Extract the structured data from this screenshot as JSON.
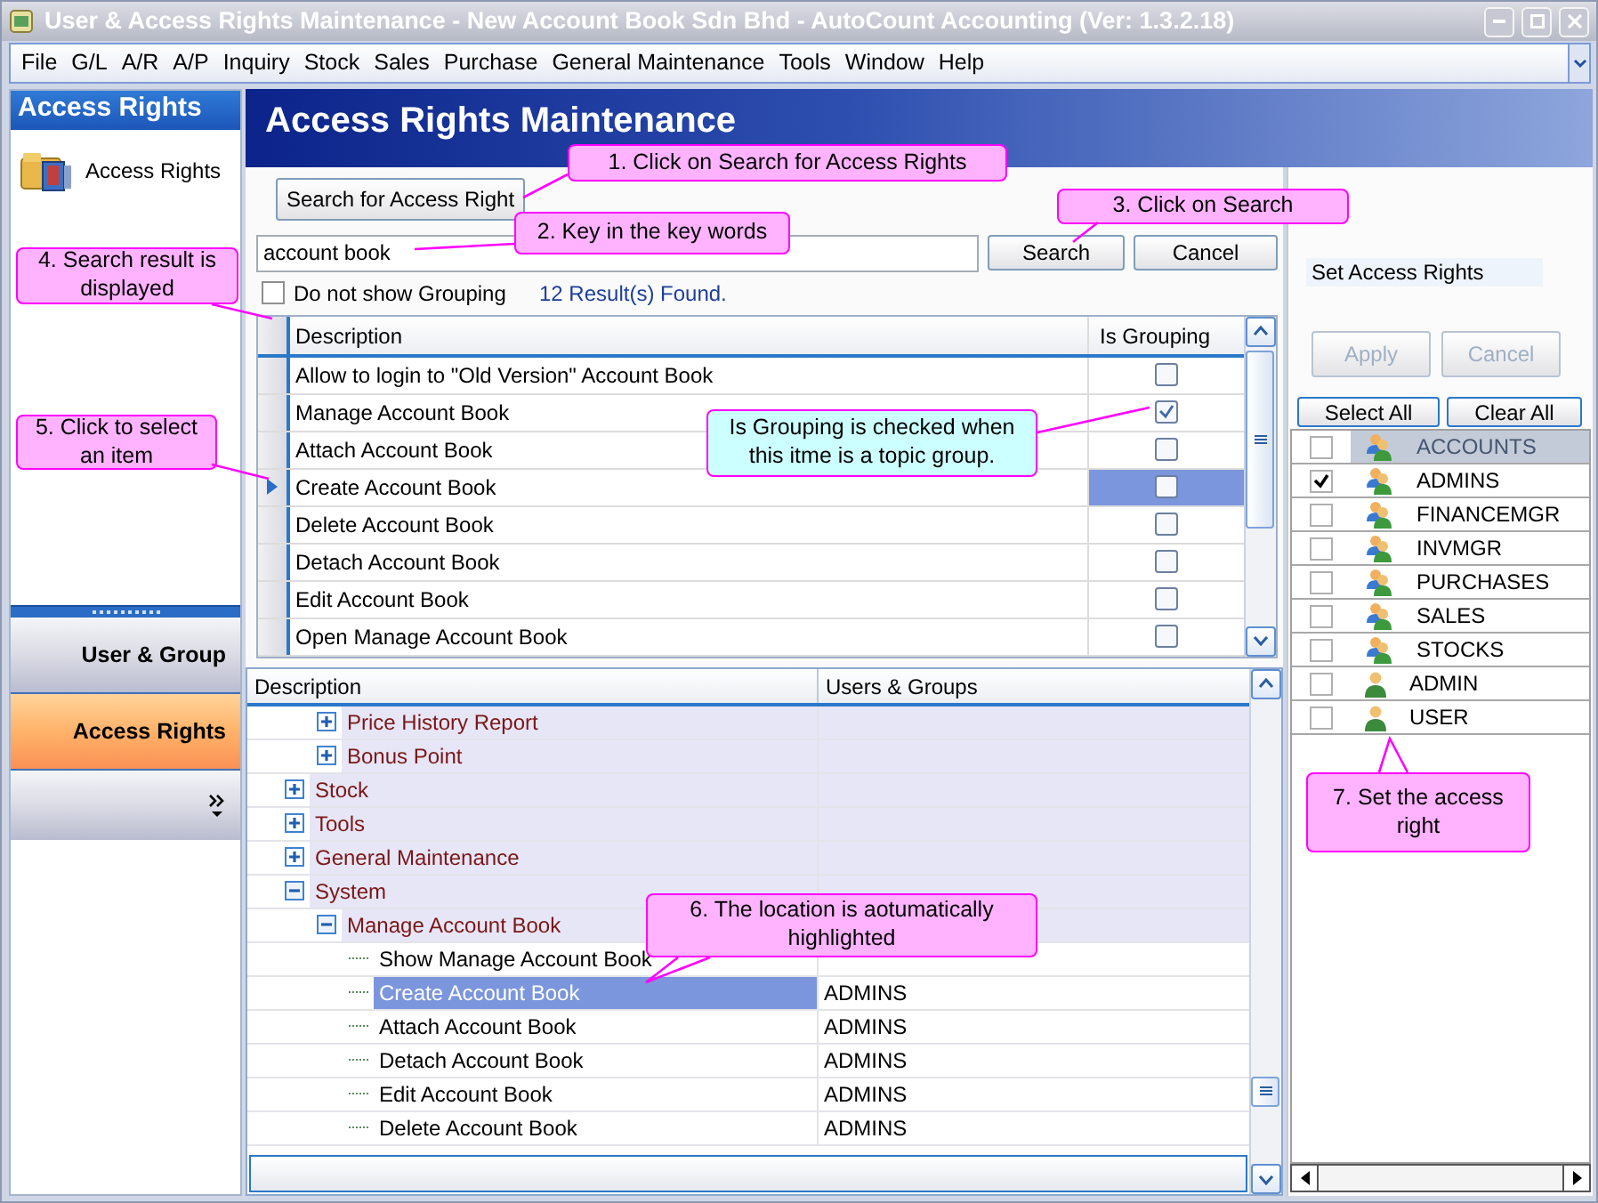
{
  "window": {
    "title": "User & Access Rights Maintenance - New Account Book Sdn Bhd - AutoCount Accounting (Ver: 1.3.2.18)"
  },
  "menu": [
    "File",
    "G/L",
    "A/R",
    "A/P",
    "Inquiry",
    "Stock",
    "Sales",
    "Purchase",
    "General Maintenance",
    "Tools",
    "Window",
    "Help"
  ],
  "sidebar": {
    "title": "Access Rights",
    "items": [
      {
        "label": "Access Rights"
      }
    ],
    "nav_buttons": [
      {
        "label": "User & Group",
        "selected": false
      },
      {
        "label": "Access Rights",
        "selected": true
      }
    ]
  },
  "header": {
    "title": "Access Rights Maintenance"
  },
  "search": {
    "search_for_button": "Search for Access Right",
    "value": "account book",
    "search_button": "Search",
    "cancel_button": "Cancel",
    "no_grouping": {
      "label": "Do not show Grouping",
      "checked": false
    },
    "result_count": "12 Result(s) Found."
  },
  "results": {
    "columns": [
      "Description",
      "Is Grouping"
    ],
    "rows": [
      {
        "description": "Allow to login to \"Old Version\" Account Book",
        "is_grouping": false,
        "selected": false
      },
      {
        "description": "Manage Account Book",
        "is_grouping": true,
        "selected": false
      },
      {
        "description": "Attach Account Book",
        "is_grouping": false,
        "selected": false
      },
      {
        "description": "Create Account Book",
        "is_grouping": false,
        "selected": true
      },
      {
        "description": "Delete Account Book",
        "is_grouping": false,
        "selected": false
      },
      {
        "description": "Detach Account Book",
        "is_grouping": false,
        "selected": false
      },
      {
        "description": "Edit Account Book",
        "is_grouping": false,
        "selected": false
      },
      {
        "description": "Open Manage Account Book",
        "is_grouping": false,
        "selected": false
      }
    ]
  },
  "tree": {
    "columns": [
      "Description",
      "Users & Groups"
    ],
    "nodes": [
      {
        "children": [
          {
            "kind": "group",
            "label": "Price History Report",
            "expanded": false,
            "selected": false
          },
          {
            "kind": "group",
            "label": "Bonus Point",
            "expanded": false,
            "selected": false
          }
        ]
      },
      {
        "kind": "group",
        "label": "Stock",
        "expanded": false,
        "selected": false
      },
      {
        "kind": "group",
        "label": "Tools",
        "expanded": false,
        "selected": false
      },
      {
        "kind": "group",
        "label": "General Maintenance",
        "expanded": false,
        "selected": false
      },
      {
        "kind": "group",
        "label": "System",
        "expanded": true,
        "selected": false,
        "children": [
          {
            "kind": "group",
            "label": "Manage Account Book",
            "expanded": true,
            "selected": false,
            "children": [
              {
                "kind": "item",
                "label": "Show Manage Account Book",
                "selected": false
              },
              {
                "kind": "item",
                "label": "Create Account Book",
                "users": "ADMINS",
                "selected": true
              },
              {
                "kind": "item",
                "label": "Attach Account Book",
                "users": "ADMINS",
                "selected": false
              },
              {
                "kind": "item",
                "label": "Detach Account Book",
                "users": "ADMINS",
                "selected": false
              },
              {
                "kind": "item",
                "label": "Edit Account Book",
                "users": "ADMINS",
                "selected": false
              },
              {
                "kind": "item",
                "label": "Delete Account Book",
                "users": "ADMINS",
                "selected": false
              }
            ]
          }
        ]
      }
    ]
  },
  "rights": {
    "title": "Set Access Rights",
    "apply": {
      "label": "Apply",
      "disabled": true
    },
    "cancel": {
      "label": "Cancel",
      "disabled": true
    },
    "select_all": "Select All",
    "clear_all": "Clear All",
    "entries": [
      {
        "name": "ACCOUNTS",
        "kind": "group",
        "checked": false,
        "selected": true
      },
      {
        "name": "ADMINS",
        "kind": "group",
        "checked": true,
        "selected": false
      },
      {
        "name": "FINANCEMGR",
        "kind": "group",
        "checked": false,
        "selected": false
      },
      {
        "name": "INVMGR",
        "kind": "group",
        "checked": false,
        "selected": false
      },
      {
        "name": "PURCHASES",
        "kind": "group",
        "checked": false,
        "selected": false
      },
      {
        "name": "SALES",
        "kind": "group",
        "checked": false,
        "selected": false
      },
      {
        "name": "STOCKS",
        "kind": "group",
        "checked": false,
        "selected": false
      },
      {
        "name": "ADMIN",
        "kind": "user",
        "checked": false,
        "selected": false
      },
      {
        "name": "USER",
        "kind": "user",
        "checked": false,
        "selected": false
      }
    ]
  },
  "callouts": [
    {
      "text": "1. Click on Search for Access Rights",
      "color": "#ffb3ff"
    },
    {
      "text": "2. Key in the key words",
      "color": "#ffb3ff"
    },
    {
      "text": "3. Click on Search",
      "color": "#ffb3ff"
    },
    {
      "text": "4. Search result is displayed",
      "color": "#ffb3ff"
    },
    {
      "text": "5. Click to select an item",
      "color": "#ffb3ff"
    },
    {
      "text": "Is Grouping is checked when this itme is a topic group.",
      "color": "#ccffff"
    },
    {
      "text": "6. The location is aotumatically highlighted",
      "color": "#ffb3ff"
    },
    {
      "text": "7. Set the access right",
      "color": "#ffb3ff"
    }
  ]
}
